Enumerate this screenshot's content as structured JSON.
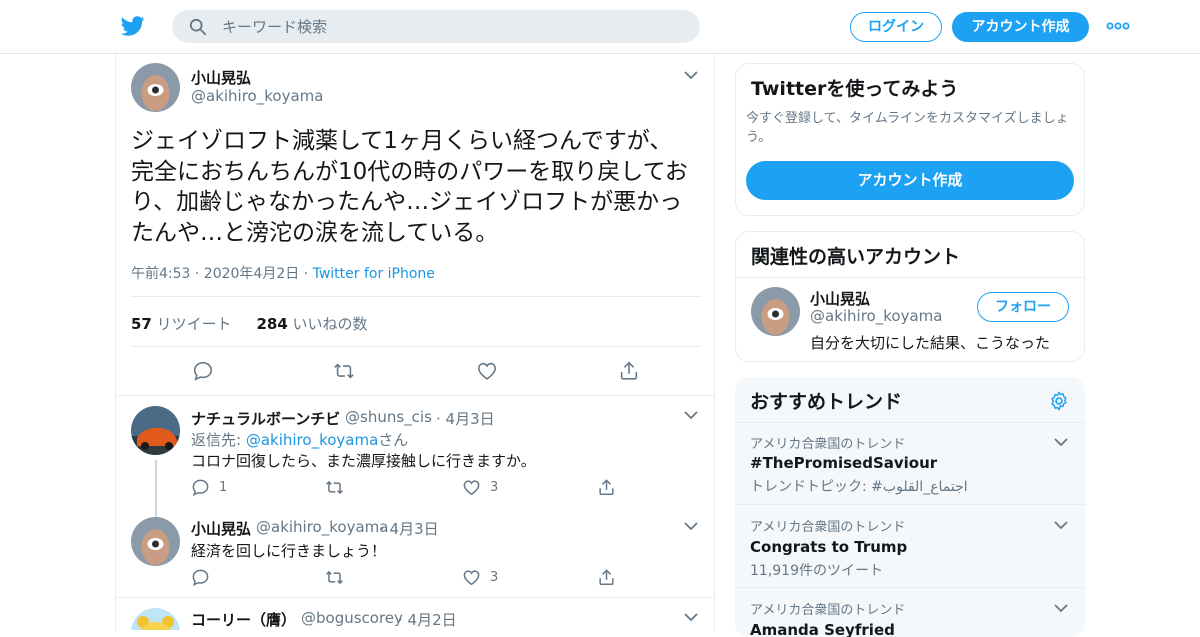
{
  "header": {
    "search_placeholder": "キーワード検索",
    "login_label": "ログイン",
    "signup_label": "アカウント作成",
    "brand_color": "#1da1f2"
  },
  "main_tweet": {
    "name": "小山晃弘",
    "handle": "@akihiro_koyama",
    "text": "ジェイゾロフト減薬して1ヶ月くらい経つんですが、完全におちんちんが10代の時のパワーを取り戻しており、加齢じゃなかったんや…ジェイゾロフトが悪かったんや…と滂沱の涙を流している。",
    "timestamp": "午前4:53 · 2020年4月2日",
    "sep": " · ",
    "source": "Twitter for iPhone",
    "retweets_count": "57",
    "retweets_label": "リツイート",
    "likes_count": "284",
    "likes_label": "いいねの数"
  },
  "replies": [
    {
      "name": "ナチュラルボーンチビ",
      "handle": "@shuns_cis",
      "date": "· 4月3日",
      "reply_to_label": "返信先: ",
      "reply_to_handle": "@akihiro_koyama",
      "reply_to_suffix": "さん",
      "text": "コロナ回復したら、また濃厚接触しに行きますか。",
      "reply_count": "1",
      "like_count": "3"
    },
    {
      "name": "小山晃弘",
      "handle": "@akihiro_koyama",
      "date": "· 4月3日",
      "text": "経済を回しに行きましょう！",
      "like_count": "3"
    },
    {
      "name": "コーリー（膺）",
      "handle": "@boguscorey",
      "date": "· 4月2日"
    }
  ],
  "sidebar": {
    "signup_card": {
      "title": "Twitterを使ってみよう",
      "desc": "今すぐ登録して、タイムラインをカスタマイズしましょう。",
      "button": "アカウント作成"
    },
    "related": {
      "title": "関連性の高いアカウント",
      "name": "小山晃弘",
      "handle": "@akihiro_koyama",
      "follow": "フォロー",
      "bio": "自分を大切にした結果、こうなった"
    },
    "trends": {
      "title": "おすすめトレンド",
      "items": [
        {
          "category": "アメリカ合衆国のトレンド",
          "name": "#ThePromisedSaviour",
          "sub": "トレンドトピック: #اجتماع_القلوب"
        },
        {
          "category": "アメリカ合衆国のトレンド",
          "name": "Congrats to Trump",
          "sub": "11,919件のツイート"
        },
        {
          "category": "アメリカ合衆国のトレンド",
          "name": "Amanda Seyfried",
          "sub": ""
        }
      ]
    }
  }
}
